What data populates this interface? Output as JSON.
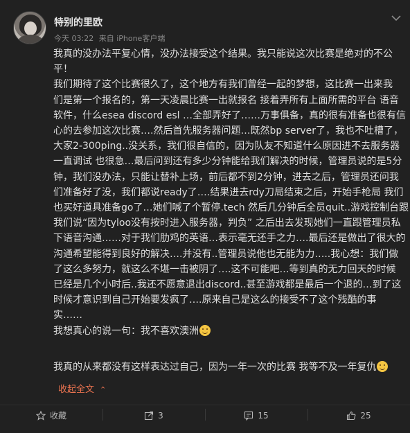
{
  "post": {
    "username": "特别的里欧",
    "time": "今天 03:22",
    "source": "来自 iPhone客户端",
    "lines": [
      "我真的没办法平复心情，没办法接受这个结果。我只能说这次比赛是绝对的不公",
      "平！",
      "我们期待了这个比赛很久了，这个地方有我们曾经一起的梦想，这比赛一出来我",
      "们是第一个报名的，第一天凌晨比赛一出就报名 接着弄所有上面所需的平台 语音",
      "软件，什么esea discord esl …全部弄好了……万事俱备，真的很有准备也很有信",
      "心的去参加这次比赛….然后首先服务器问题…既然bp server了，我也不吐槽了，",
      "大家2-300ping..没关系，我们很自信的，因为队友不知道什么原因进不去服务器",
      "一直调试 也很急…最后问到还有多少分钟能给我们解决的时候，管理员说的是5分",
      "钟，我们没办法，只能让替补上场，前后都不到2分钟，进去之后，管理员还问我",
      "们准备好了没，我们都说ready了….结果进去rdy刀局结束之后，开始手枪局 我们",
      "也买好道具准备go了…她们喊了个暂停.tech 然后几分钟后全员quit..游戏控制台跟",
      "我们说“因为tyloo没有按时进入服务器，判负” 之后出去发现她们一直跟管理员私",
      "下语音沟通……对于我们肋鸡的英语…表示毫无还手之力….最后还是做出了很大的",
      "沟通希望能得到良好的解决….并没有..管理员说他也无能为力…..我心想：我们做",
      "了这么多努力，就这么不堪一击被阴了….这不可能吧…等到真的无力回天的时候",
      "已经是几个小时后..我还不愿意退出discord..甚至游戏都是最后一个退的…到了这",
      "时候才意识到自己开始要发疯了….原来自己是这么的接受不了这个残酷的事",
      "实……",
      "我想真心的说一句：我不喜欢澳洲"
    ],
    "last_line": "我真的从来都没有这样表达过自己，因为一年一次的比赛 我等不及一年复仇",
    "collapse_label": "收起全文",
    "collapse_icon": "chevron-up-icon"
  },
  "actions": {
    "favorite_label": "收藏",
    "repost_count": "3",
    "comment_count": "15",
    "like_count": "25"
  },
  "colors": {
    "accent": "#eb7350",
    "background": "#212121",
    "text": "#dedede",
    "meta": "#8a8a8a"
  }
}
